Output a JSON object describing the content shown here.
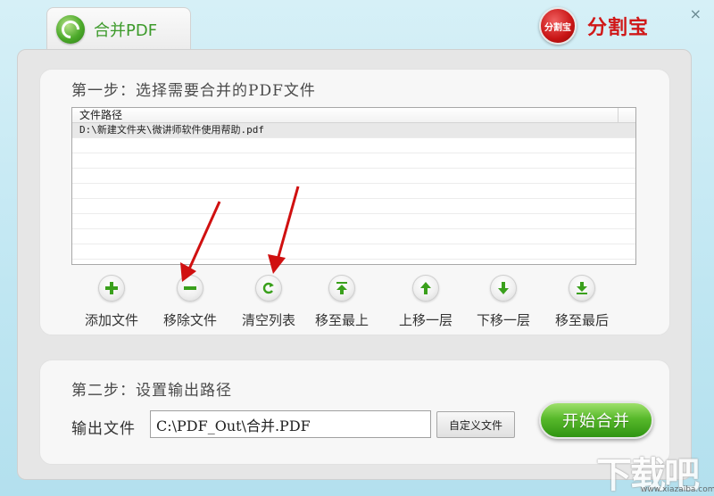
{
  "window": {
    "close_label": "×"
  },
  "tab": {
    "title": "合并PDF"
  },
  "brand": {
    "seal_text": "分割宝",
    "name": "分割宝"
  },
  "step1": {
    "title": "第一步：选择需要合并的PDF文件",
    "list": {
      "header": "文件路径",
      "rows": [
        "D:\\新建文件夹\\微讲师软件使用帮助.pdf",
        "",
        "",
        "",
        "",
        "",
        "",
        "",
        ""
      ]
    },
    "tools": [
      {
        "name": "add-file",
        "label": "添加文件",
        "icon": "plus-icon"
      },
      {
        "name": "remove-file",
        "label": "移除文件",
        "icon": "minus-icon"
      },
      {
        "name": "clear-list",
        "label": "清空列表",
        "icon": "refresh-icon"
      },
      {
        "name": "move-top",
        "label": "移至最上",
        "icon": "arrow-top-icon"
      },
      {
        "name": "move-up",
        "label": "上移一层",
        "icon": "arrow-up-icon"
      },
      {
        "name": "move-down",
        "label": "下移一层",
        "icon": "arrow-down-icon"
      },
      {
        "name": "move-bottom",
        "label": "移至最后",
        "icon": "arrow-bottom-icon"
      }
    ]
  },
  "step2": {
    "title": "第二步：设置输出路径",
    "output_label": "输出文件",
    "output_value": "C:\\PDF_Out\\合并.PDF",
    "custom_button": "自定义文件",
    "start_button": "开始合并"
  },
  "watermark": {
    "text": "下载吧",
    "url": "www.xiazaiba.com"
  },
  "colors": {
    "accent_green": "#58b92b",
    "icon_green": "#3aa01c",
    "brand_red": "#d01818",
    "arrow_red": "#d01010"
  }
}
